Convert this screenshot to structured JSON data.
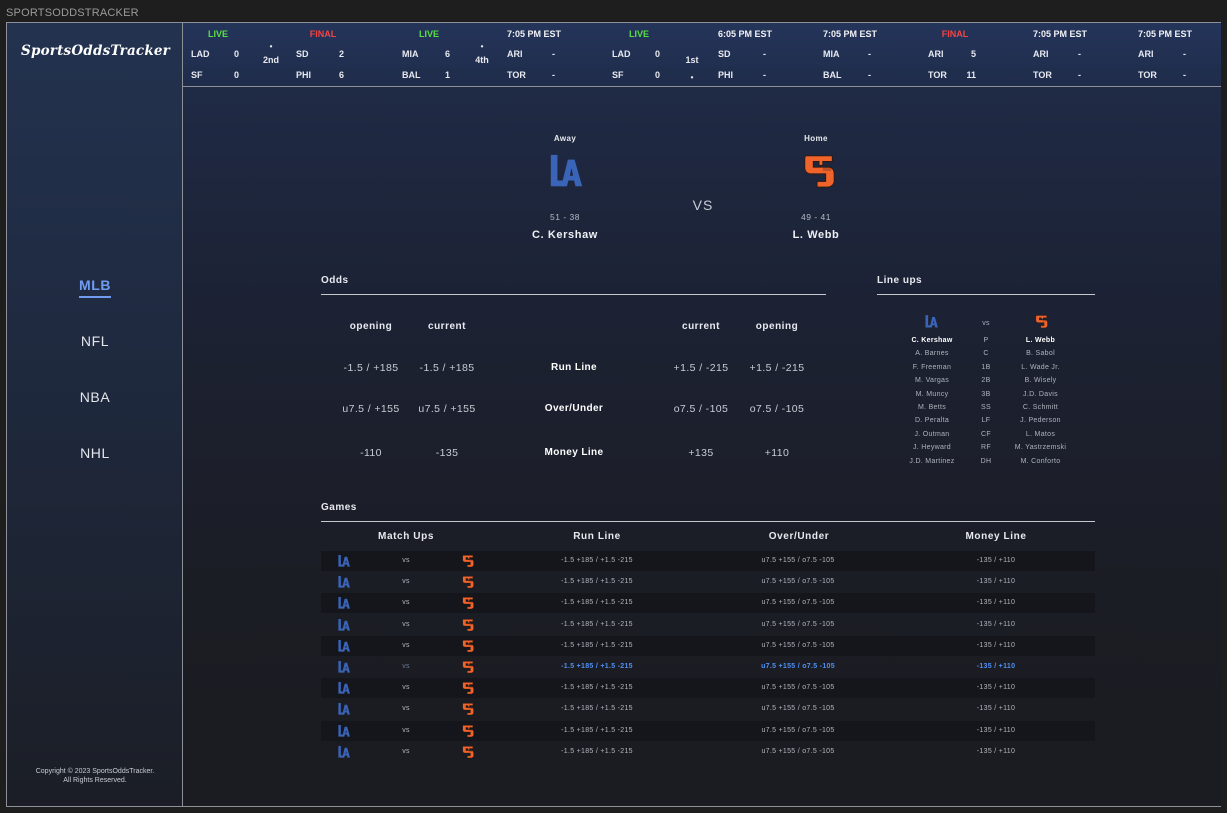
{
  "caption": "SPORTSODDSTRACKER",
  "logo": "SportsOddsTracker",
  "nav": [
    "MLB",
    "NFL",
    "NBA",
    "NHL"
  ],
  "copyright": [
    "Copyright © 2023 SportsOddsTracker.",
    "All Rights Reserved."
  ],
  "colors": {
    "dodgers_blue": "#3a64b8",
    "giants_orange": "#f0632a",
    "live": "#58e044",
    "final": "#f04545",
    "selected_row": "#4f8ff5"
  },
  "ticker": [
    {
      "status": "LIVE",
      "kind": "live",
      "away": "LAD",
      "home": "SF",
      "away_score": "0",
      "home_score": "0",
      "inning": "2nd",
      "dot": "•"
    },
    {
      "status": "FINAL",
      "kind": "final",
      "away": "SD",
      "home": "PHI",
      "away_score": "2",
      "home_score": "6",
      "inning": "",
      "dot": ""
    },
    {
      "status": "LIVE",
      "kind": "live",
      "away": "MIA",
      "home": "BAL",
      "away_score": "6",
      "home_score": "1",
      "inning": "4th",
      "dot": "•"
    },
    {
      "status": "7:05 PM EST",
      "kind": "time",
      "away": "ARI",
      "home": "TOR",
      "away_score": "-",
      "home_score": "-",
      "inning": "",
      "dot": ""
    },
    {
      "status": "LIVE",
      "kind": "live",
      "away": "LAD",
      "home": "SF",
      "away_score": "0",
      "home_score": "0",
      "inning": "1st",
      "dot": "•"
    },
    {
      "status": "6:05 PM EST",
      "kind": "time",
      "away": "SD",
      "home": "PHI",
      "away_score": "-",
      "home_score": "-",
      "inning": "",
      "dot": ""
    },
    {
      "status": "7:05 PM EST",
      "kind": "time",
      "away": "MIA",
      "home": "BAL",
      "away_score": "-",
      "home_score": "-",
      "inning": "",
      "dot": ""
    },
    {
      "status": "FINAL",
      "kind": "final",
      "away": "ARI",
      "home": "TOR",
      "away_score": "5",
      "home_score": "11",
      "inning": "",
      "dot": ""
    },
    {
      "status": "7:05 PM EST",
      "kind": "time",
      "away": "ARI",
      "home": "TOR",
      "away_score": "-",
      "home_score": "-",
      "inning": "",
      "dot": ""
    },
    {
      "status": "7:05 PM EST",
      "kind": "time",
      "away": "ARI",
      "home": "TOR",
      "away_score": "-",
      "home_score": "-",
      "inning": "",
      "dot": ""
    }
  ],
  "matchup": {
    "away_label": "Away",
    "home_label": "Home",
    "away_record": "51 - 38",
    "home_record": "49 - 41",
    "away_pitcher": "C. Kershaw",
    "home_pitcher": "L. Webb",
    "vs": "VS"
  },
  "odds": {
    "title": "Odds",
    "headers": [
      "opening",
      "current",
      "current",
      "opening"
    ],
    "rows": [
      {
        "label": "Run Line",
        "away_open": "-1.5 / +185",
        "away_cur": "-1.5 / +185",
        "home_cur": "+1.5 / -215",
        "home_open": "+1.5 / -215"
      },
      {
        "label": "Over/Under",
        "away_open": "u7.5 / +155",
        "away_cur": "u7.5 / +155",
        "home_cur": "o7.5 / -105",
        "home_open": "o7.5 / -105"
      },
      {
        "label": "Money Line",
        "away_open": "-110",
        "away_cur": "-135",
        "home_cur": "+135",
        "home_open": "+110"
      }
    ]
  },
  "lineups": {
    "title": "Line ups",
    "vs": "vs",
    "rows": [
      {
        "away": "C. Kershaw",
        "pos": "P",
        "home": "L. Webb"
      },
      {
        "away": "A. Barnes",
        "pos": "C",
        "home": "B. Sabol"
      },
      {
        "away": "F. Freeman",
        "pos": "1B",
        "home": "L. Wade Jr."
      },
      {
        "away": "M. Vargas",
        "pos": "2B",
        "home": "B. Wisely"
      },
      {
        "away": "M. Muncy",
        "pos": "3B",
        "home": "J.D. Davis"
      },
      {
        "away": "M. Betts",
        "pos": "SS",
        "home": "C. Schmitt"
      },
      {
        "away": "D. Peralta",
        "pos": "LF",
        "home": "J. Pederson"
      },
      {
        "away": "J. Outman",
        "pos": "CF",
        "home": "L. Matos"
      },
      {
        "away": "J. Heyward",
        "pos": "RF",
        "home": "M. Yastrzemski"
      },
      {
        "away": "J.D. Martinez",
        "pos": "DH",
        "home": "M. Conforto"
      }
    ]
  },
  "games": {
    "title": "Games",
    "headers": [
      "Match Ups",
      "Run Line",
      "Over/Under",
      "Money Line"
    ],
    "rows": [
      {
        "vs": "vs",
        "run_line": "-1.5 +185 / +1.5 -215",
        "over_under": "u7.5 +155 / o7.5 -105",
        "money_line": "-135 / +110"
      },
      {
        "vs": "vs",
        "run_line": "-1.5 +185 / +1.5 -215",
        "over_under": "u7.5 +155 / o7.5 -105",
        "money_line": "-135 / +110"
      },
      {
        "vs": "vs",
        "run_line": "-1.5 +185 / +1.5 -215",
        "over_under": "u7.5 +155 / o7.5 -105",
        "money_line": "-135 / +110"
      },
      {
        "vs": "vs",
        "run_line": "-1.5 +185 / +1.5 -215",
        "over_under": "u7.5 +155 / o7.5 -105",
        "money_line": "-135 / +110"
      },
      {
        "vs": "vs",
        "run_line": "-1.5 +185 / +1.5 -215",
        "over_under": "u7.5 +155 / o7.5 -105",
        "money_line": "-135 / +110"
      },
      {
        "vs": "vs",
        "run_line": "-1.5 +185 / +1.5 -215",
        "over_under": "u7.5 +155 / o7.5 -105",
        "money_line": "-135 / +110"
      },
      {
        "vs": "vs",
        "run_line": "-1.5 +185 / +1.5 -215",
        "over_under": "u7.5 +155 / o7.5 -105",
        "money_line": "-135 / +110"
      },
      {
        "vs": "vs",
        "run_line": "-1.5 +185 / +1.5 -215",
        "over_under": "u7.5 +155 / o7.5 -105",
        "money_line": "-135 / +110"
      },
      {
        "vs": "vs",
        "run_line": "-1.5 +185 / +1.5 -215",
        "over_under": "u7.5 +155 / o7.5 -105",
        "money_line": "-135 / +110"
      },
      {
        "vs": "vs",
        "run_line": "-1.5 +185 / +1.5 -215",
        "over_under": "u7.5 +155 / o7.5 -105",
        "money_line": "-135 / +110"
      }
    ],
    "selected_index": 5
  }
}
